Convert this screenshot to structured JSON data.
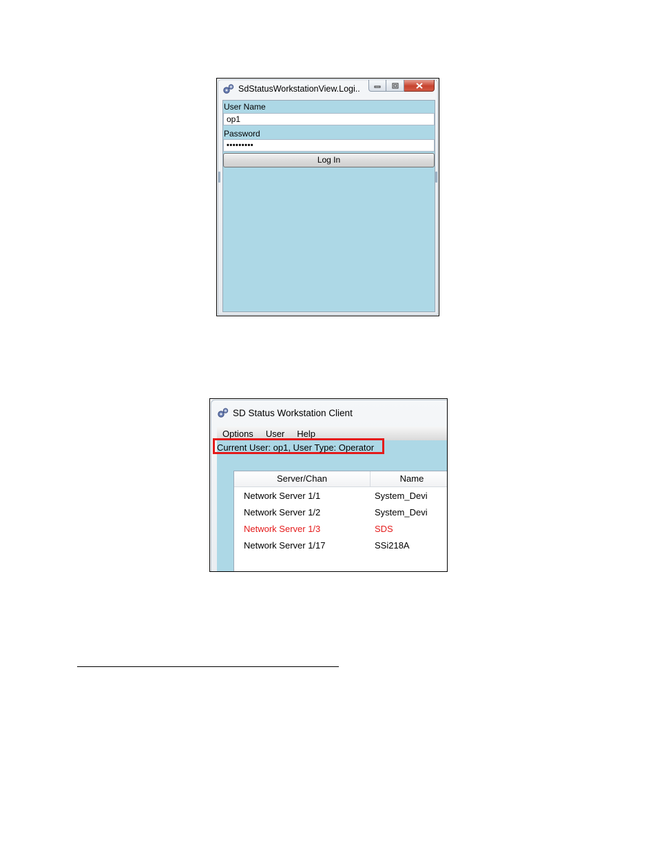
{
  "login_window": {
    "title": "SdStatusWorkstationView.Logi...",
    "icon": "gears-icon",
    "caption_buttons": {
      "minimize": "minimize-icon",
      "maximize": "maximize-icon",
      "close": "close-icon"
    },
    "username_label": "User Name",
    "username_value": "op1",
    "password_label": "Password",
    "password_value": "•••••••••",
    "login_button": "Log In"
  },
  "client_window": {
    "title": "SD Status Workstation Client",
    "icon": "gears-icon",
    "menu": [
      "Options",
      "User",
      "Help"
    ],
    "status": "Current User: op1, User Type: Operator",
    "highlight_color": "#e41b1b",
    "table": {
      "columns": [
        "Server/Chan",
        "Name"
      ],
      "rows": [
        {
          "server": "Network Server 1/1",
          "name": "System_Devi",
          "alarm": false
        },
        {
          "server": "Network Server 1/2",
          "name": "System_Devi",
          "alarm": false
        },
        {
          "server": "Network Server 1/3",
          "name": "SDS",
          "alarm": true
        },
        {
          "server": "Network Server 1/17",
          "name": "SSi218A",
          "alarm": false
        }
      ]
    }
  },
  "colors": {
    "client_background": "#add8e6",
    "alarm_text": "#e41b1b"
  }
}
